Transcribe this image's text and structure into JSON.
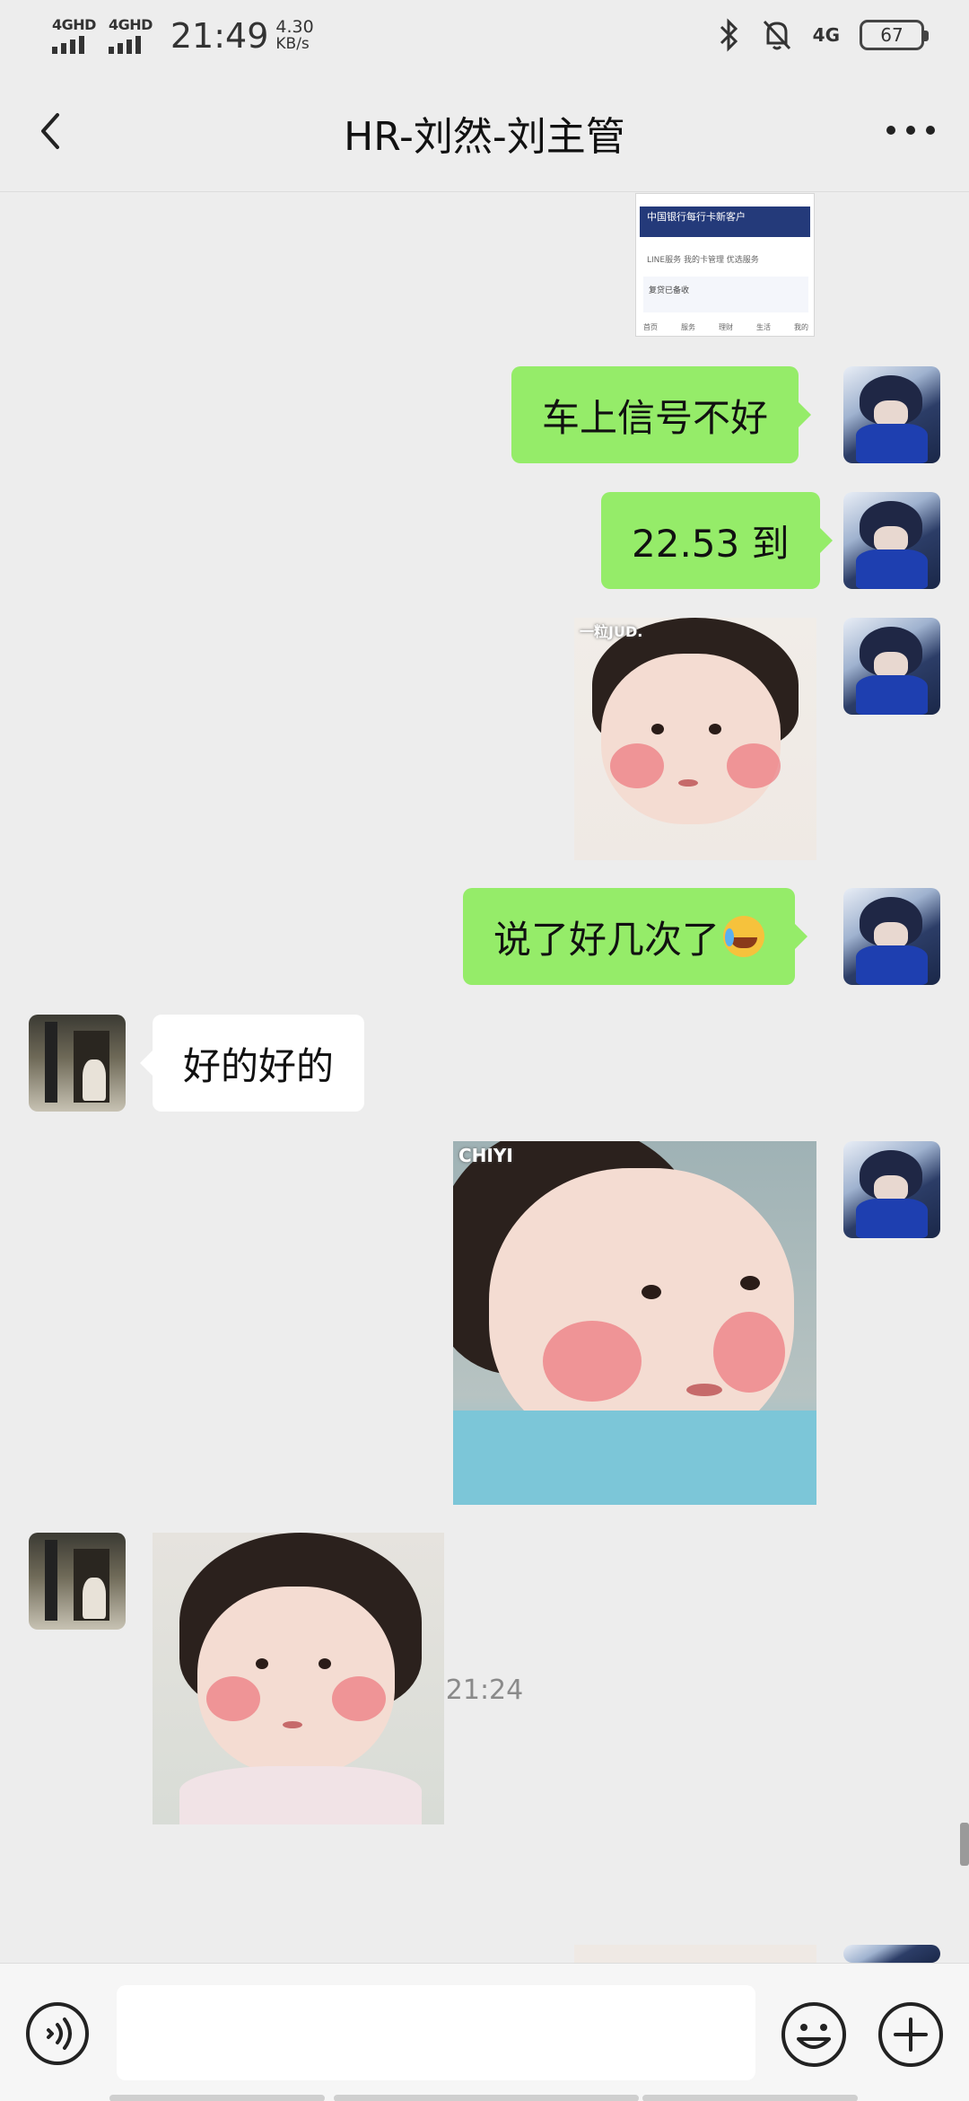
{
  "status_bar": {
    "sim1": "4GHD",
    "sim2": "4GHD",
    "time": "21:49",
    "speed_value": "4.30",
    "speed_unit": "KB/s",
    "network": "4G",
    "battery": "67"
  },
  "header": {
    "title": "HR-刘然-刘主管"
  },
  "screenshot_thumb": {
    "banner": "中国银行每行卡新客户",
    "tabs": "LINE服务  我的卡管理  优选服务",
    "card": "复贷已备收",
    "nav": [
      "首页",
      "服务",
      "理财",
      "生活",
      "我的"
    ]
  },
  "messages": [
    {
      "side": "me",
      "type": "text",
      "text": "车上信号不好"
    },
    {
      "side": "me",
      "type": "text",
      "text": "22.53 到"
    },
    {
      "side": "me",
      "type": "image",
      "watermark": "一粒JUD."
    },
    {
      "side": "me",
      "type": "text",
      "text": "说了好几次了"
    },
    {
      "side": "other",
      "type": "text",
      "text": "好的好的"
    },
    {
      "side": "me",
      "type": "image",
      "watermark": "CHIYI"
    },
    {
      "side": "other",
      "type": "image",
      "watermark": ""
    }
  ],
  "timestamp": "21:24",
  "input": {
    "value": "",
    "placeholder": ""
  },
  "colors": {
    "background": "#ededed",
    "my_bubble": "#95ec69",
    "other_bubble": "#ffffff"
  },
  "icons": [
    "back-arrow-icon",
    "more-dots-icon",
    "voice-icon",
    "emoji-icon",
    "plus-icon",
    "bluetooth-icon",
    "mute-bell-icon"
  ]
}
